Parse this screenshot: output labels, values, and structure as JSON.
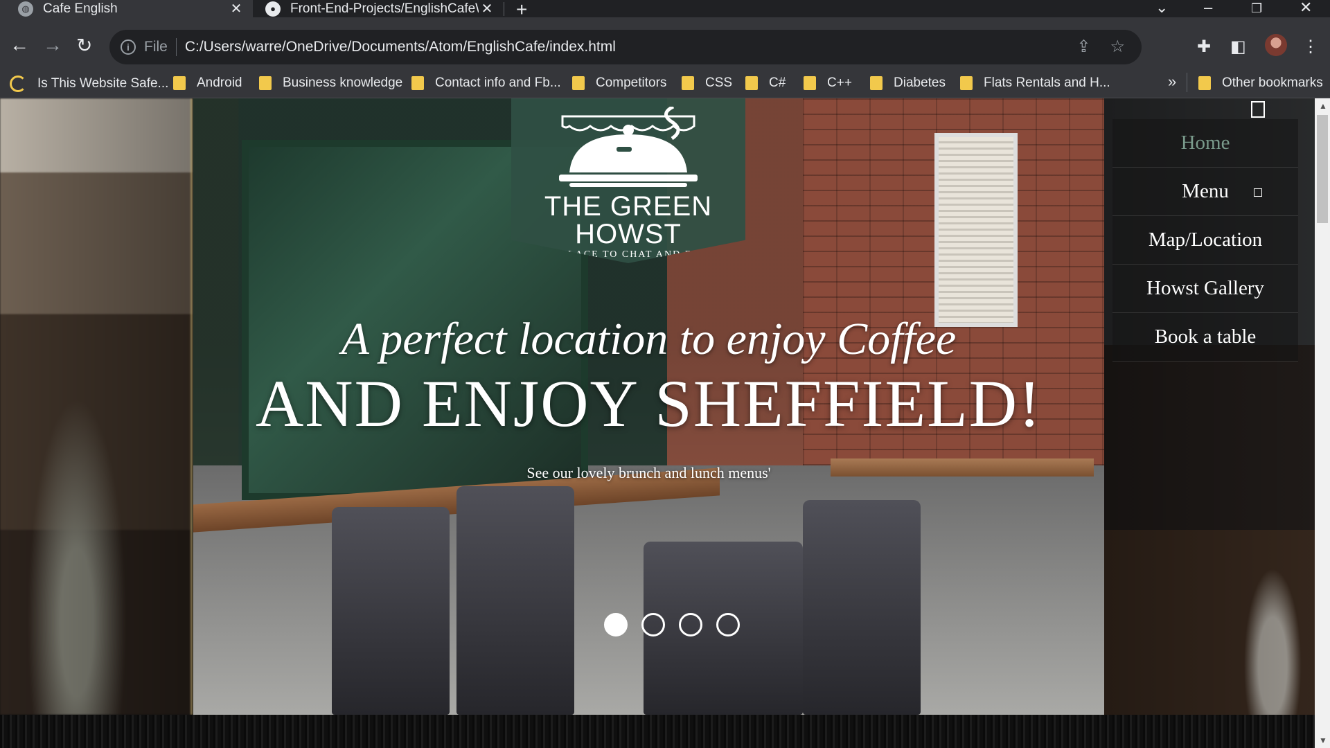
{
  "browser": {
    "tabs": [
      {
        "title": "Cafe English",
        "close": "✕"
      },
      {
        "title": "Front-End-Projects/EnglishCafeW",
        "close": "✕"
      }
    ],
    "new_tab": "+",
    "address": {
      "scheme_label": "File",
      "url": "C:/Users/warre/OneDrive/Documents/Atom/EnglishCafe/index.html"
    },
    "bookmarks": [
      "Is This Website Safe...",
      "Android",
      "Business knowledge",
      "Contact info and Fb...",
      "Competitors",
      "CSS",
      "C#",
      "C++",
      "Diabetes",
      "Flats Rentals and H..."
    ],
    "more_bookmarks": "»",
    "other_bookmarks": "Other bookmarks"
  },
  "page": {
    "logo": {
      "line1": "THE GREEN",
      "line2": "HOWST",
      "tagline": "A PLACE TO CHAT AND EAT"
    },
    "hero": {
      "headline_italic": "A perfect location to enjoy Coffee",
      "headline_caps": "AND ENJOY SHEFFIELD!",
      "subline": "See our lovely brunch and lunch menus'"
    },
    "carousel": {
      "total": 4,
      "active": 1
    },
    "nav": [
      {
        "label": "Home",
        "active": true
      },
      {
        "label": "Menu",
        "active": false,
        "has_dropdown": true
      },
      {
        "label": "Map/Location",
        "active": false
      },
      {
        "label": "Howst Gallery",
        "active": false
      },
      {
        "label": "Book a table",
        "active": false
      }
    ]
  },
  "colors": {
    "banner_green": "#2f5044",
    "nav_active": "#7a9b8c",
    "chrome_dark": "#202124",
    "chrome_toolbar": "#35363a"
  }
}
